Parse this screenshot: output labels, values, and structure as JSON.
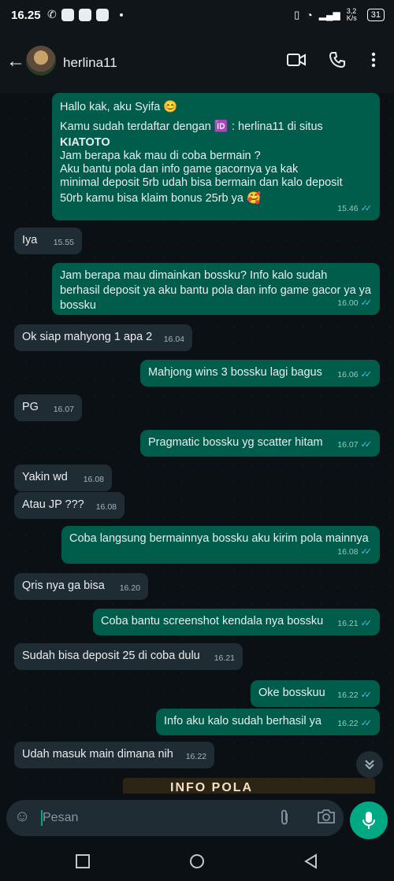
{
  "status": {
    "time": "16.25",
    "net_speed": "3,2 K/s",
    "battery": "31"
  },
  "header": {
    "contact_name": "herlina11"
  },
  "messages": [
    {
      "dir": "out",
      "lines": [
        "Hallo kak, aku Syifa 😊",
        "Kamu sudah terdaftar dengan 🆔 : herlina11 di situs",
        "KIATOTO",
        "Jam berapa kak mau di coba bermain ?",
        "Aku bantu pola dan info game gacornya ya kak",
        "minimal deposit 5rb udah bisa bermain dan kalo deposit",
        "50rb kamu bisa klaim bonus 25rb ya 🥰"
      ],
      "time": "15.46",
      "ticks": "✓✓"
    },
    {
      "dir": "in",
      "text": "Iya",
      "time": "15.55"
    },
    {
      "dir": "out",
      "lines": [
        "Jam berapa mau dimainkan bossku? Info kalo sudah",
        "berhasil deposit ya aku bantu pola dan info game gacor ya ya",
        "bossku"
      ],
      "time": "16.00",
      "ticks": "✓✓"
    },
    {
      "dir": "in",
      "text": "Ok siap mahyong 1 apa 2",
      "time": "16.04"
    },
    {
      "dir": "out",
      "text": "Mahjong wins 3 bossku lagi bagus",
      "time": "16.06",
      "ticks": "✓✓"
    },
    {
      "dir": "in",
      "text": "PG",
      "time": "16.07"
    },
    {
      "dir": "out",
      "text": "Pragmatic bossku yg scatter hitam",
      "time": "16.07",
      "ticks": "✓✓"
    },
    {
      "dir": "in",
      "text": "Yakin wd",
      "time": "16.08"
    },
    {
      "dir": "in",
      "text": "Atau JP ???",
      "time": "16.08"
    },
    {
      "dir": "out",
      "text": "Coba langsung bermainnya bossku aku kirim pola mainnya",
      "time": "16.08",
      "ticks": "✓✓"
    },
    {
      "dir": "in",
      "text": "Qris nya ga bisa",
      "time": "16.20"
    },
    {
      "dir": "out",
      "text": "Coba bantu screenshot kendala nya bossku",
      "time": "16.21",
      "ticks": "✓✓"
    },
    {
      "dir": "in",
      "text": "Sudah bisa deposit 25 di coba dulu",
      "time": "16.21"
    },
    {
      "dir": "out",
      "text": "Oke bosskuu",
      "time": "16.22",
      "ticks": "✓✓"
    },
    {
      "dir": "out",
      "text": "Info aku kalo sudah berhasil ya",
      "time": "16.22",
      "ticks": "✓✓"
    },
    {
      "dir": "in",
      "text": "Udah masuk main dimana nih",
      "time": "16.22"
    }
  ],
  "preview_text": "INFO POLA",
  "composer": {
    "placeholder": "Pesan"
  },
  "colors": {
    "accent": "#00a884",
    "outgoing": "#005c4b",
    "incoming": "#1f2c33",
    "read_ticks": "#53bdeb"
  }
}
